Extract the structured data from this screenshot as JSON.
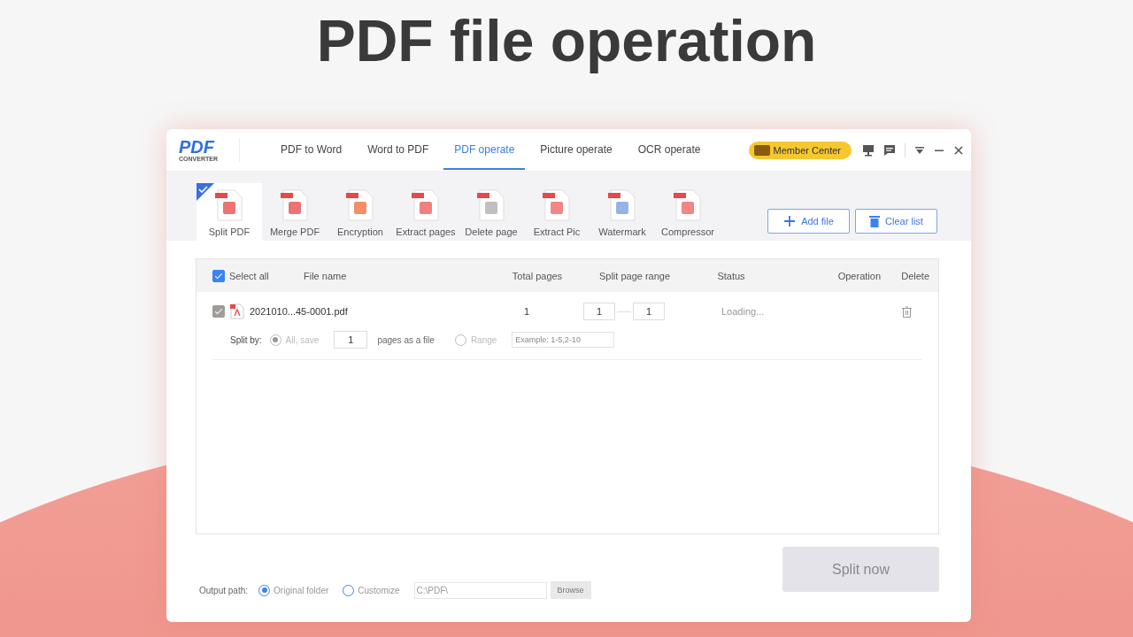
{
  "headline": "PDF file operation",
  "logo": {
    "title": "PDF",
    "subtitle": "CONVERTER"
  },
  "tabs": [
    {
      "label": "PDF to Word",
      "selected": false
    },
    {
      "label": "Word to PDF",
      "selected": false
    },
    {
      "label": "PDF operate",
      "selected": true
    },
    {
      "label": "Picture operate",
      "selected": false
    },
    {
      "label": "OCR operate",
      "selected": false
    }
  ],
  "member_center": "Member Center",
  "tools": [
    {
      "label": "Split PDF",
      "selected": true
    },
    {
      "label": "Merge PDF",
      "selected": false
    },
    {
      "label": "Encryption",
      "selected": false
    },
    {
      "label": "Extract pages",
      "selected": false
    },
    {
      "label": "Delete page",
      "selected": false
    },
    {
      "label": "Extract Pic",
      "selected": false
    },
    {
      "label": "Watermark",
      "selected": false
    },
    {
      "label": "Compressor",
      "selected": false
    }
  ],
  "add_file": "Add file",
  "clear_list": "Clear list",
  "select_all": {
    "label": "Select all",
    "checked": true
  },
  "columns": [
    "File name",
    "Total pages",
    "Split page range",
    "Status",
    "Operation",
    "Delete"
  ],
  "rows": [
    {
      "checked": true,
      "file_name": "2021010...45-0001.pdf",
      "total_pages": "1",
      "range_from": "1",
      "range_to": "1",
      "status": "Loading...",
      "split_by": "Split by:",
      "options": [
        {
          "label": "All, save",
          "selected": true
        },
        {
          "label": "Range",
          "selected": false
        }
      ],
      "pages_value": "1",
      "pages_suffix": "pages as a file",
      "range_placeholder": "Example: 1-5,2-10"
    }
  ],
  "output": {
    "label": "Output path:",
    "options": [
      {
        "label": "Original folder",
        "selected": true
      },
      {
        "label": "Customize",
        "selected": false
      }
    ],
    "path": "C:\\PDF\\",
    "browse": "Browse"
  },
  "split_now": {
    "label": "Split now",
    "disabled": true
  }
}
